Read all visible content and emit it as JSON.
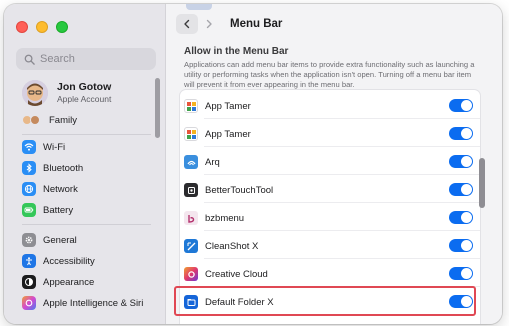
{
  "window": {
    "title": "Menu Bar"
  },
  "sidebar": {
    "search_placeholder": "Search",
    "account": {
      "name": "Jon Gotow",
      "subtitle": "Apple Account"
    },
    "family": {
      "label": "Family"
    },
    "items": [
      {
        "label": "Wi-Fi",
        "icon": "wifi-icon",
        "color": "#2a8ef5"
      },
      {
        "label": "Bluetooth",
        "icon": "bluetooth-icon",
        "color": "#2a8ef5"
      },
      {
        "label": "Network",
        "icon": "network-globe-icon",
        "color": "#2a8ef5"
      },
      {
        "label": "Battery",
        "icon": "battery-icon",
        "color": "#34c759"
      },
      {
        "label": "General",
        "icon": "gear-icon",
        "color": "#8e8e93"
      },
      {
        "label": "Accessibility",
        "icon": "accessibility-icon",
        "color": "#1f76e6"
      },
      {
        "label": "Appearance",
        "icon": "appearance-icon",
        "color": "#1c1c1e"
      },
      {
        "label": "Apple Intelligence & Siri",
        "icon": "siri-icon",
        "color": "#b04ad9"
      }
    ]
  },
  "main": {
    "section_title": "Allow in the Menu Bar",
    "section_description": "Applications can add menu bar items to provide extra functionality such as launching a utility or performing tasks when the application isn't open. Turning off a menu bar item will prevent it from ever appearing in the menu bar.",
    "apps": [
      {
        "name": "App Tamer",
        "icon": "app-tamer-icon",
        "enabled": true
      },
      {
        "name": "App Tamer",
        "icon": "app-tamer-icon",
        "enabled": true
      },
      {
        "name": "Arq",
        "icon": "arq-icon",
        "enabled": true
      },
      {
        "name": "BetterTouchTool",
        "icon": "bettertouchtool-icon",
        "enabled": true
      },
      {
        "name": "bzbmenu",
        "icon": "bzbmenu-icon",
        "enabled": true
      },
      {
        "name": "CleanShot X",
        "icon": "cleanshot-icon",
        "enabled": true
      },
      {
        "name": "Creative Cloud",
        "icon": "creative-cloud-icon",
        "enabled": true
      },
      {
        "name": "Default Folder X",
        "icon": "default-folder-icon",
        "enabled": true
      }
    ]
  },
  "colors": {
    "accent": "#0b6cf0",
    "highlight": "#e04854"
  }
}
